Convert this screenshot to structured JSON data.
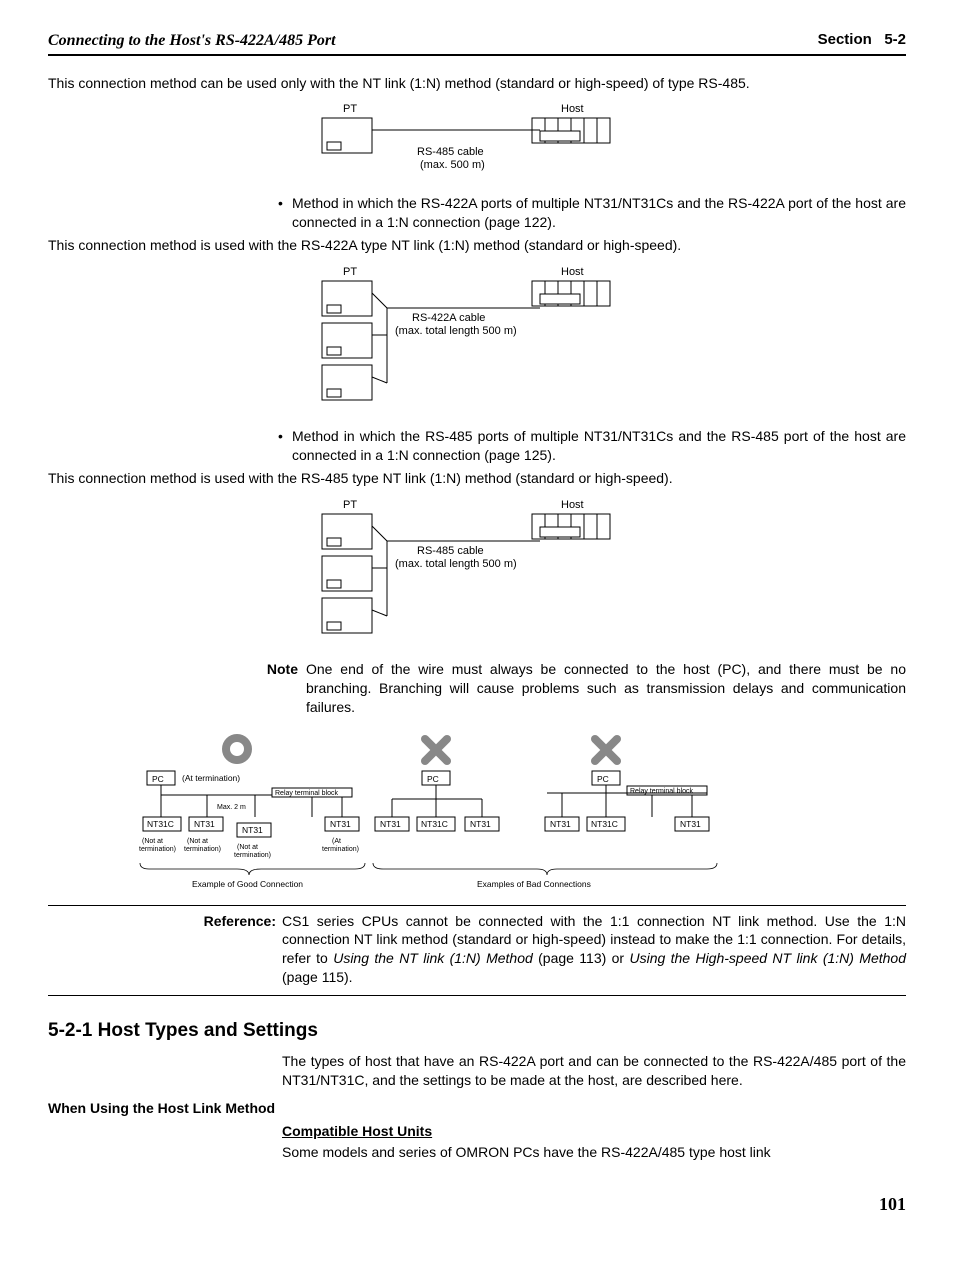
{
  "header": {
    "left": "Connecting to the Host's RS-422A/485 Port",
    "right_label": "Section",
    "right_num": "5-2"
  },
  "p1": "This connection method can be used only with the NT link (1:N) method (standard or high-speed) of type RS-485.",
  "d1": {
    "pt": "PT",
    "host": "Host",
    "cable": "RS-485 cable",
    "len": "(max. 500 m)"
  },
  "b1": "Method in which the RS-422A ports of multiple NT31/NT31Cs and the RS-422A port of the host are connected in a 1:N connection (page 122).",
  "p2": "This connection method is used with the RS-422A type NT link (1:N) method (standard or high-speed).",
  "d2": {
    "pt": "PT",
    "host": "Host",
    "cable": "RS-422A cable",
    "len": "(max. total length 500 m)"
  },
  "b2": "Method in which the RS-485 ports of multiple NT31/NT31Cs and the RS-485 port of the host are connected in a 1:N connection (page 125).",
  "p3": "This connection method is used with the RS-485 type NT link (1:N) method (standard or high-speed).",
  "d3": {
    "pt": "PT",
    "host": "Host",
    "cable": "RS-485 cable",
    "len": "(max. total length 500 m)"
  },
  "note_lbl": "Note",
  "note": "One end of the wire must always be connected to the host (PC), and there must be no branching. Branching will cause problems such as transmission delays and communication failures.",
  "d4": {
    "pc": "PC",
    "at_term": "(At termination)",
    "relay": "Relay terminal block",
    "max2m": "Max. 2 m",
    "nt31c": "NT31C",
    "nt31": "NT31",
    "not_at": "(Not at",
    "term": "termination)",
    "at": "(At",
    "good": "Example of Good Connection",
    "bad": "Examples of Bad Connections"
  },
  "ref_lbl": "Reference:",
  "ref_1": "CS1 series CPUs cannot be connected with the 1:1 connection NT link method. Use the 1:N connection NT link method (standard or high-speed) instead to make the 1:1 connection. For details, refer to ",
  "ref_i1": "Using the NT link (1:N) Method",
  "ref_2": " (page 113) or ",
  "ref_i2": "Using the High-speed NT link (1:N) Method",
  "ref_3": " (page 115).",
  "sec": "5-2-1  Host Types and Settings",
  "p4": "The types of host that have an RS-422A port and can be connected to the RS-422A/485 port of the NT31/NT31C, and the settings to be made at the host, are described here.",
  "sub": "When Using the Host Link Method",
  "ulh": "Compatible Host Units",
  "p5": "Some models and series of OMRON PCs have the RS-422A/485 type host link",
  "page": "101"
}
